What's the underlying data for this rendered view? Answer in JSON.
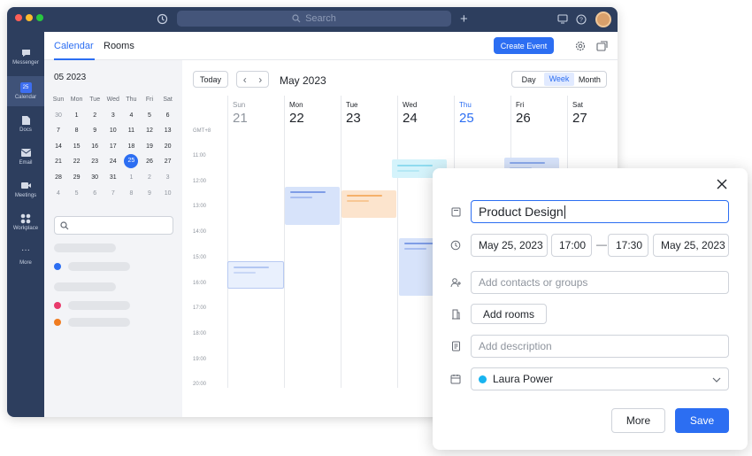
{
  "titlebar": {
    "search_placeholder": "Search",
    "colors": {
      "bar": "#2d3e5e",
      "close": "#ff5f57",
      "min": "#febc2e",
      "max": "#28c840"
    }
  },
  "rail": {
    "items": [
      {
        "label": "Messenger",
        "icon": "messenger-icon"
      },
      {
        "label": "Calendar",
        "icon": "calendar-icon",
        "badge": "25",
        "active": true
      },
      {
        "label": "Docs",
        "icon": "docs-icon"
      },
      {
        "label": "Email",
        "icon": "email-icon"
      },
      {
        "label": "Meetings",
        "icon": "meetings-icon"
      },
      {
        "label": "Workplace",
        "icon": "workplace-icon"
      },
      {
        "label": "More",
        "icon": "more-icon"
      }
    ]
  },
  "header": {
    "tabs": [
      {
        "label": "Calendar",
        "active": true
      },
      {
        "label": "Rooms"
      }
    ],
    "create_label": "Create Event"
  },
  "mini_calendar": {
    "title": "05 2023",
    "weekdays": [
      "Sun",
      "Mon",
      "Tue",
      "Wed",
      "Thu",
      "Fri",
      "Sat"
    ],
    "weeks": [
      [
        "30",
        "1",
        "2",
        "3",
        "4",
        "5",
        "6"
      ],
      [
        "7",
        "8",
        "9",
        "10",
        "11",
        "12",
        "13"
      ],
      [
        "14",
        "15",
        "16",
        "17",
        "18",
        "19",
        "20"
      ],
      [
        "21",
        "22",
        "23",
        "24",
        "25",
        "26",
        "27"
      ],
      [
        "28",
        "29",
        "30",
        "31",
        "1",
        "2",
        "3"
      ],
      [
        "4",
        "5",
        "6",
        "7",
        "8",
        "9",
        "10"
      ]
    ],
    "selected": "25",
    "accent": "#2c6ef2"
  },
  "toolbar": {
    "today_label": "Today",
    "prev": "‹",
    "next": "›",
    "month_label": "May 2023",
    "views": [
      "Day",
      "Week",
      "Month"
    ],
    "active_view": "Week"
  },
  "week": {
    "timezone": "GMT+8",
    "days": [
      {
        "name": "Sun",
        "date": "21",
        "muted": true
      },
      {
        "name": "Mon",
        "date": "22"
      },
      {
        "name": "Tue",
        "date": "23"
      },
      {
        "name": "Wed",
        "date": "24"
      },
      {
        "name": "Thu",
        "date": "25",
        "today": true
      },
      {
        "name": "Fri",
        "date": "26"
      },
      {
        "name": "Sat",
        "date": "27"
      }
    ],
    "hours": [
      "11:00",
      "12:00",
      "13:00",
      "14:00",
      "15:00",
      "16:00",
      "17:00",
      "18:00",
      "19:00",
      "20:00"
    ]
  },
  "dialog": {
    "title_value": "Product Design",
    "start_date": "May 25, 2023",
    "start_time": "17:00",
    "dash": "—",
    "end_time": "17:30",
    "end_date": "May 25, 2023",
    "contacts_placeholder": "Add contacts or groups",
    "rooms_label": "Add rooms",
    "description_placeholder": "Add description",
    "calendar_owner": "Laura Power",
    "owner_color": "#18b4f0",
    "more_label": "More",
    "save_label": "Save"
  }
}
